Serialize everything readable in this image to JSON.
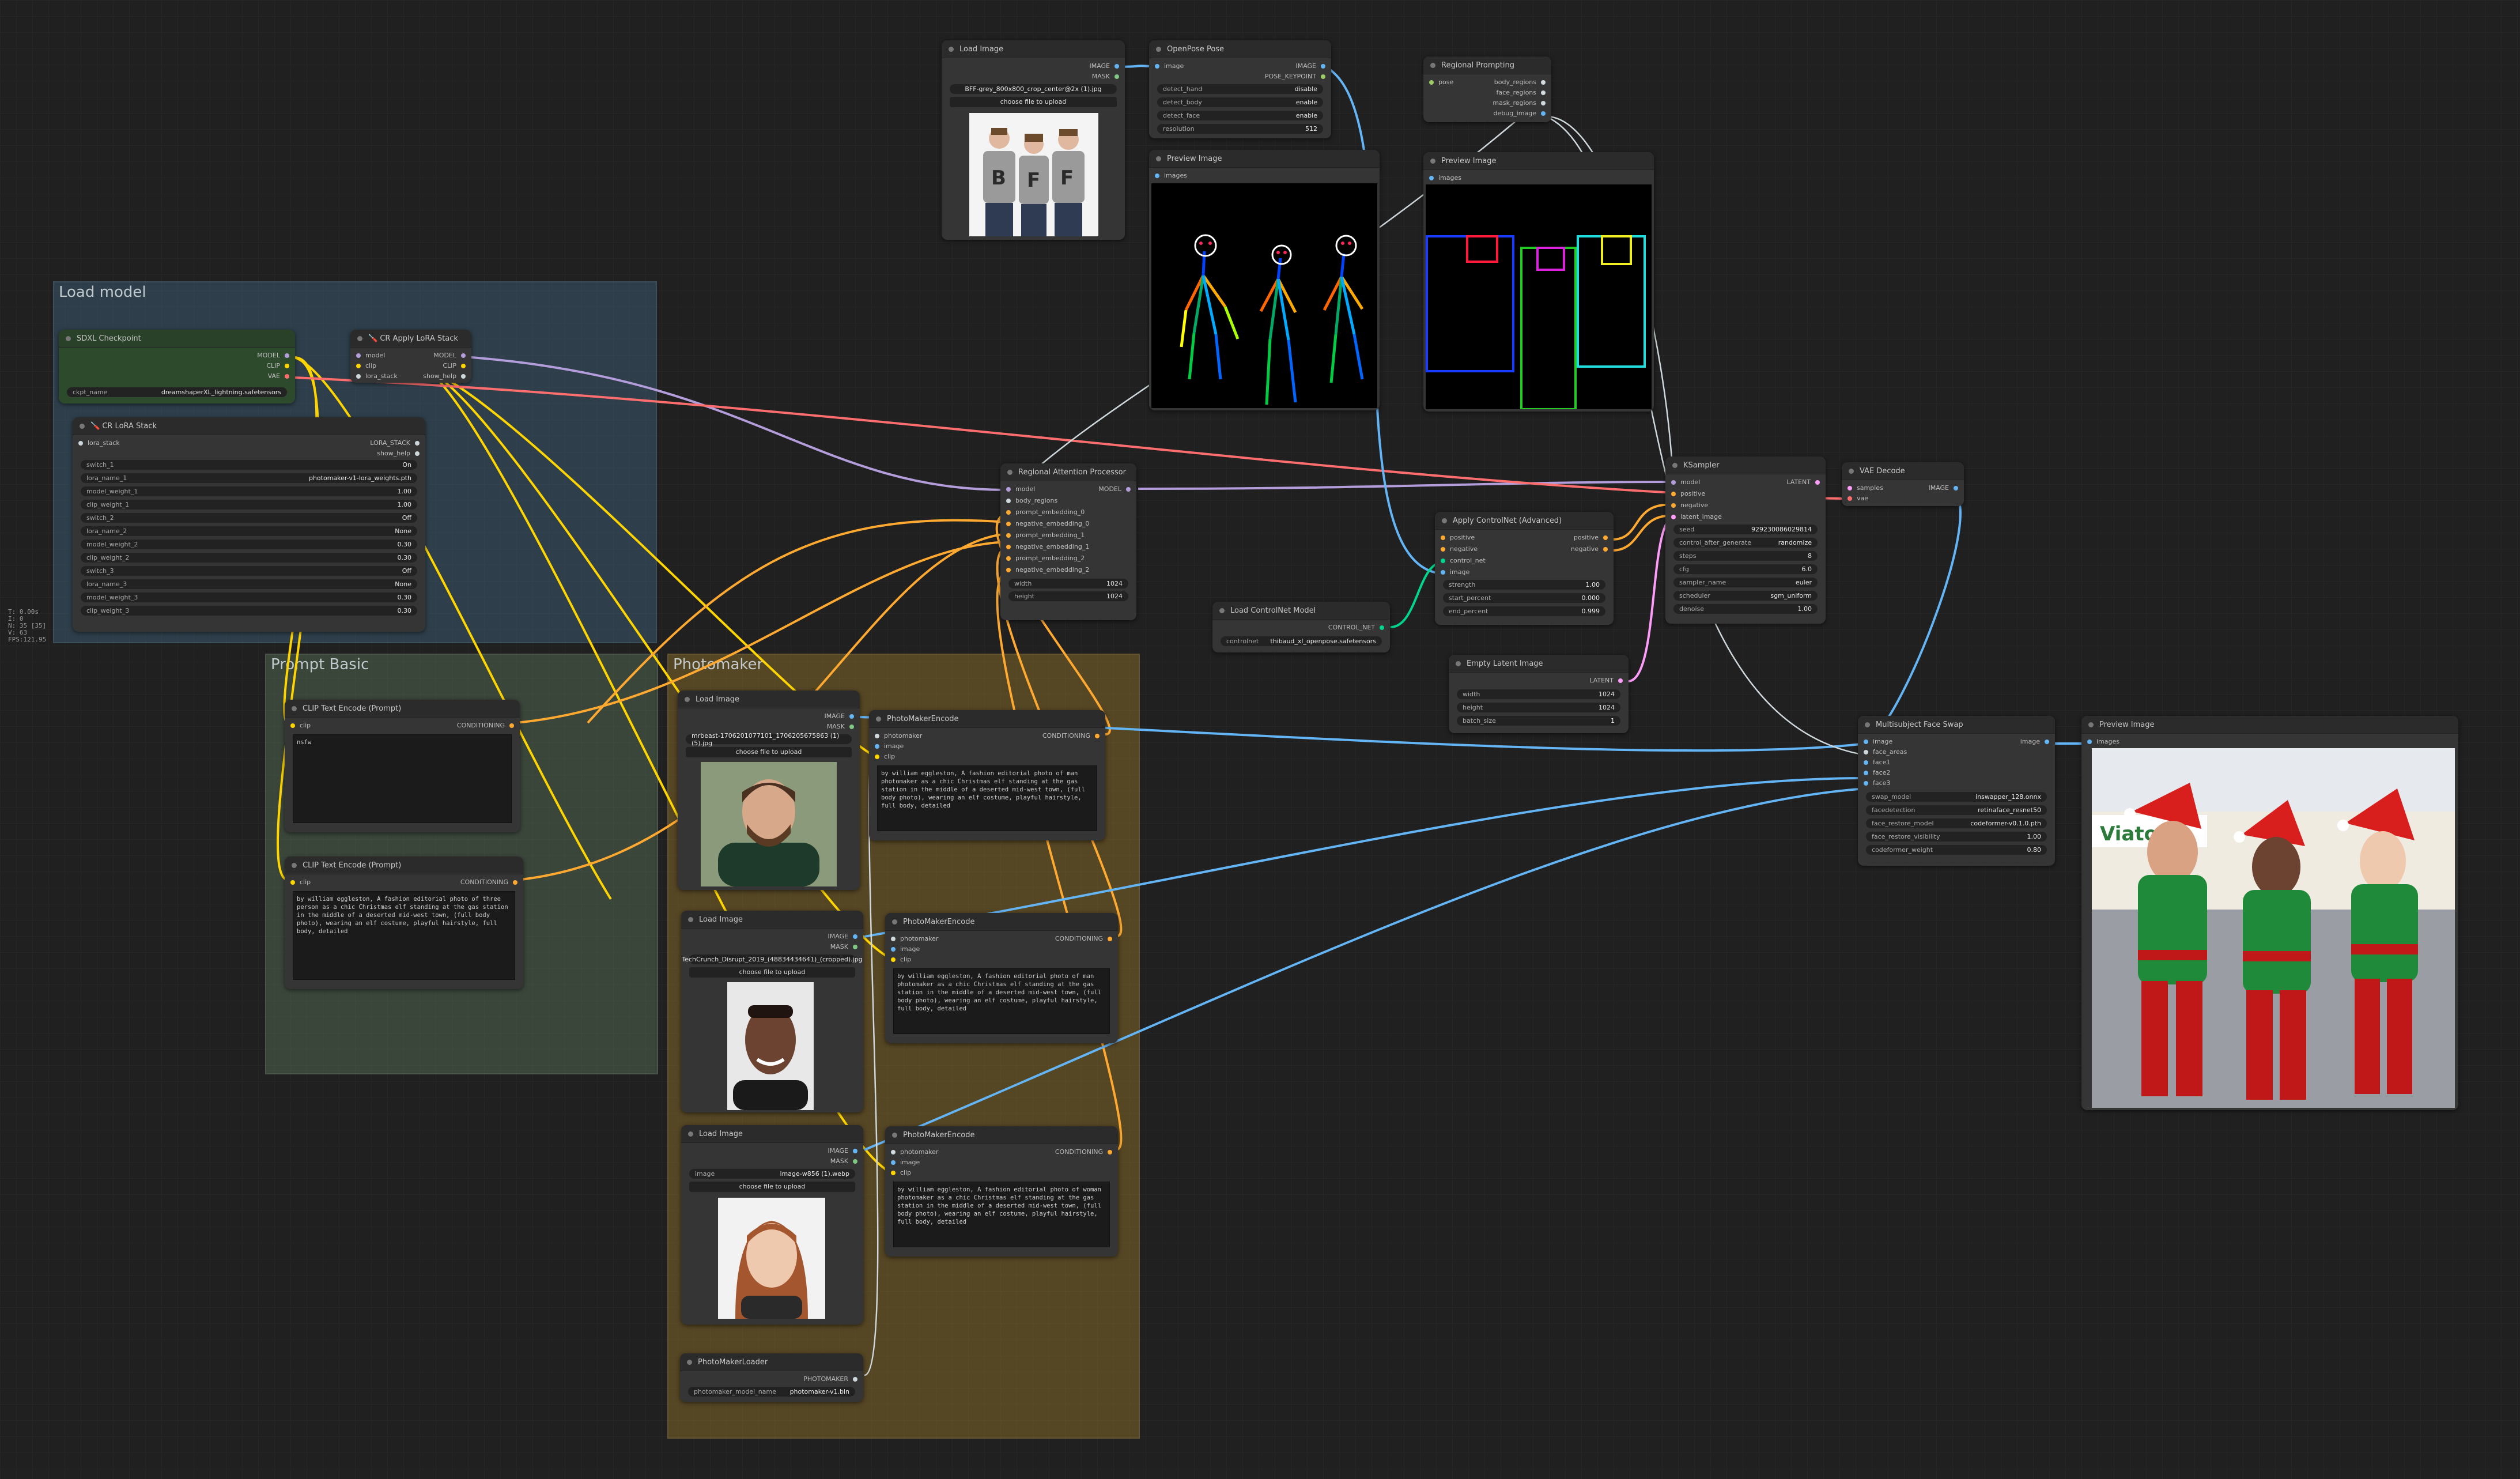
{
  "stats": [
    "T: 0.00s",
    "I: 0",
    "N: 35 [35]",
    "V: 63",
    "FPS:121.95"
  ],
  "groups": {
    "load_model": "Load model",
    "prompt_basic": "Prompt Basic",
    "photomaker": "Photomaker"
  },
  "colors": {
    "model": "#b39ddb",
    "clip": "#ffd500",
    "vae": "#ff6e6e",
    "image": "#64b5f6",
    "conditioning": "#ffa931",
    "latent": "#ff9cf9",
    "mask": "#81c784",
    "control": "#00d78d",
    "pose": "#9ccc65",
    "photomaker": "#cfd8dc"
  },
  "nodes": {
    "sdxl": {
      "title": "SDXL Checkpoint",
      "out": [
        "MODEL",
        "CLIP",
        "VAE"
      ],
      "w_label": "ckpt_name",
      "w_value": "dreamshaperXL_lightning.safetensors"
    },
    "apply_lora": {
      "title": "🪛 CR Apply LoRA Stack",
      "in": [
        "model",
        "clip",
        "lora_stack"
      ],
      "out": [
        "MODEL",
        "CLIP",
        "show_help"
      ]
    },
    "lora_stack": {
      "title": "🪛 CR LoRA Stack",
      "in": "lora_stack",
      "out": [
        "LORA_STACK",
        "show_help"
      ],
      "widgets": [
        [
          "switch_1",
          "On"
        ],
        [
          "lora_name_1",
          "photomaker-v1-lora_weights.pth"
        ],
        [
          "model_weight_1",
          "1.00"
        ],
        [
          "clip_weight_1",
          "1.00"
        ],
        [
          "switch_2",
          "Off"
        ],
        [
          "lora_name_2",
          "None"
        ],
        [
          "model_weight_2",
          "0.30"
        ],
        [
          "clip_weight_2",
          "0.30"
        ],
        [
          "switch_3",
          "Off"
        ],
        [
          "lora_name_3",
          "None"
        ],
        [
          "model_weight_3",
          "0.30"
        ],
        [
          "clip_weight_3",
          "0.30"
        ]
      ]
    },
    "load_image_top": {
      "title": "Load Image",
      "out": [
        "IMAGE",
        "MASK"
      ],
      "file": "BFF-grey_800x800_crop_center@2x (1).jpg",
      "button": "choose file to upload"
    },
    "openpose": {
      "title": "OpenPose Pose",
      "in": "image",
      "out": [
        "IMAGE",
        "POSE_KEYPOINT"
      ],
      "widgets": [
        [
          "detect_hand",
          "disable"
        ],
        [
          "detect_body",
          "enable"
        ],
        [
          "detect_face",
          "enable"
        ],
        [
          "resolution",
          "512"
        ]
      ]
    },
    "regional_prompting": {
      "title": "Regional Prompting",
      "in": "pose",
      "out": [
        "body_regions",
        "face_regions",
        "mask_regions",
        "debug_image"
      ]
    },
    "preview_pose": {
      "title": "Preview Image",
      "in": "images"
    },
    "preview_regions": {
      "title": "Preview Image",
      "in": "images"
    },
    "regional_attention": {
      "title": "Regional Attention Processor",
      "in": [
        "model",
        "body_regions",
        "prompt_embedding_0",
        "negative_embedding_0",
        "prompt_embedding_1",
        "negative_embedding_1",
        "prompt_embedding_2",
        "negative_embedding_2"
      ],
      "out": "MODEL",
      "widgets": [
        [
          "width",
          "1024"
        ],
        [
          "height",
          "1024"
        ]
      ]
    },
    "ksampler": {
      "title": "KSampler",
      "in": [
        "model",
        "positive",
        "negative",
        "latent_image"
      ],
      "out": "LATENT",
      "widgets": [
        [
          "seed",
          "929230086029814"
        ],
        [
          "control_after_generate",
          "randomize"
        ],
        [
          "steps",
          "8"
        ],
        [
          "cfg",
          "6.0"
        ],
        [
          "sampler_name",
          "euler"
        ],
        [
          "scheduler",
          "sgm_uniform"
        ],
        [
          "denoise",
          "1.00"
        ]
      ]
    },
    "vae_decode": {
      "title": "VAE Decode",
      "in": [
        "samples",
        "vae"
      ],
      "out": "IMAGE"
    },
    "apply_controlnet": {
      "title": "Apply ControlNet (Advanced)",
      "in": [
        "positive",
        "negative",
        "control_net",
        "image"
      ],
      "out": [
        "positive",
        "negative"
      ],
      "widgets": [
        [
          "strength",
          "1.00"
        ],
        [
          "start_percent",
          "0.000"
        ],
        [
          "end_percent",
          "0.999"
        ]
      ]
    },
    "load_controlnet": {
      "title": "Load ControlNet Model",
      "out": "CONTROL_NET",
      "w_label": "controlnet",
      "w_value": "thibaud_xl_openpose.safetensors"
    },
    "empty_latent": {
      "title": "Empty Latent Image",
      "out": "LATENT",
      "widgets": [
        [
          "width",
          "1024"
        ],
        [
          "height",
          "1024"
        ],
        [
          "batch_size",
          "1"
        ]
      ]
    },
    "clip_neg": {
      "title": "CLIP Text Encode (Prompt)",
      "in": "clip",
      "out": "CONDITIONING",
      "text": "nsfw"
    },
    "clip_pos": {
      "title": "CLIP Text Encode (Prompt)",
      "in": "clip",
      "out": "CONDITIONING",
      "text": "by william eggleston, A fashion editorial photo of three person as a chic Christmas elf standing at the gas station in the middle of a deserted mid-west town, (full body photo), wearing an elf costume, playful hairstyle, full body, detailed"
    },
    "load_img_1": {
      "title": "Load Image",
      "out": [
        "IMAGE",
        "MASK"
      ],
      "file": "mrbeast-1706201077101_1706205675863 (1) (5).jpg",
      "button": "choose file to upload"
    },
    "load_img_2": {
      "title": "Load Image",
      "out": [
        "IMAGE",
        "MASK"
      ],
      "file": "TechCrunch_Disrupt_2019_(48834434641)_(cropped).jpg",
      "button": "choose file to upload"
    },
    "load_img_3": {
      "title": "Load Image",
      "out": [
        "IMAGE",
        "MASK"
      ],
      "w_label": "image",
      "file": "image-w856 (1).webp",
      "button": "choose file to upload"
    },
    "pm_enc_1": {
      "title": "PhotoMakerEncode",
      "in": [
        "photomaker",
        "image",
        "clip"
      ],
      "out": "CONDITIONING",
      "text": "by william eggleston, A fashion editorial photo of man photomaker as a chic Christmas elf standing at the gas station in the middle of a deserted mid-west town, (full body photo), wearing an elf costume, playful hairstyle, full body, detailed"
    },
    "pm_enc_2": {
      "title": "PhotoMakerEncode",
      "in": [
        "photomaker",
        "image",
        "clip"
      ],
      "out": "CONDITIONING",
      "text": "by william eggleston, A fashion editorial photo of man photomaker as a chic Christmas elf standing at the gas station in the middle of a deserted mid-west town, (full body photo), wearing an elf costume, playful hairstyle, full body, detailed"
    },
    "pm_enc_3": {
      "title": "PhotoMakerEncode",
      "in": [
        "photomaker",
        "image",
        "clip"
      ],
      "out": "CONDITIONING",
      "text": "by william eggleston, A fashion editorial photo of woman photomaker as a chic Christmas elf standing at the gas station in the middle of a deserted mid-west town, (full body photo), wearing an elf costume, playful hairstyle, full body, detailed"
    },
    "pm_loader": {
      "title": "PhotoMakerLoader",
      "out": "PHOTOMAKER",
      "w_label": "photomaker_model_name",
      "w_value": "photomaker-v1.bin"
    },
    "face_swap": {
      "title": "Multisubject Face Swap",
      "in": [
        "image",
        "face_areas",
        "face1",
        "face2",
        "face3"
      ],
      "out": "image",
      "widgets": [
        [
          "swap_model",
          "inswapper_128.onnx"
        ],
        [
          "facedetection",
          "retinaface_resnet50"
        ],
        [
          "face_restore_model",
          "codeformer-v0.1.0.pth"
        ],
        [
          "face_restore_visibility",
          "1.00"
        ],
        [
          "codeformer_weight",
          "0.80"
        ]
      ]
    },
    "preview_final": {
      "title": "Preview Image",
      "in": "images",
      "sign": "Viators"
    }
  }
}
